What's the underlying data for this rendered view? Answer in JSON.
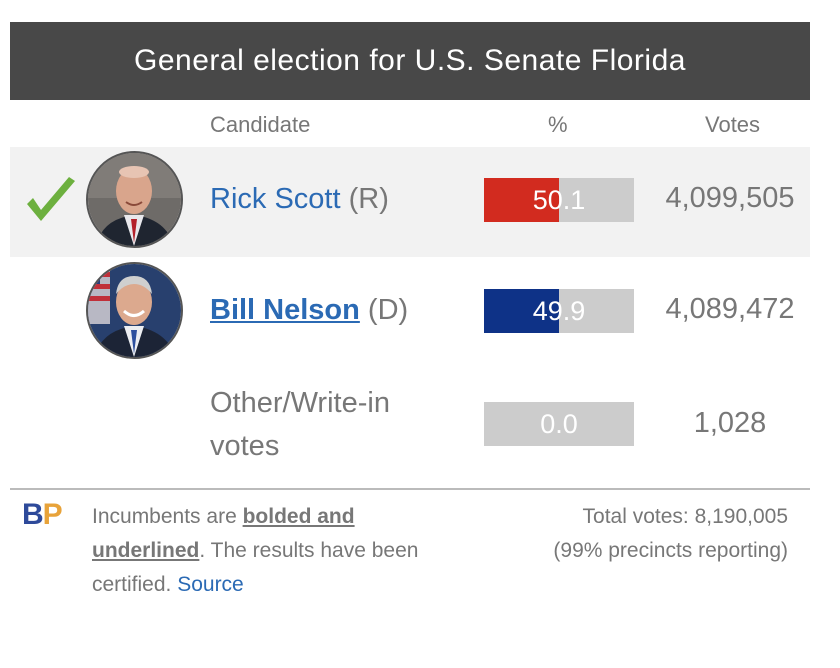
{
  "header": {
    "title": "General election for U.S. Senate Florida"
  },
  "columns": {
    "candidate": "Candidate",
    "percent": "%",
    "votes": "Votes"
  },
  "colors": {
    "republican": "#d22b1f",
    "democrat": "#0e3287",
    "bar_bg": "#cccccc",
    "winner_check": "#6db03f",
    "link": "#2b6ab4"
  },
  "candidates": [
    {
      "name": "Rick Scott",
      "party": "(R)",
      "percent": "50.1",
      "percent_value": 50.1,
      "votes": "4,099,505",
      "winner": true,
      "incumbent": false
    },
    {
      "name": "Bill Nelson",
      "party": "(D)",
      "percent": "49.9",
      "percent_value": 49.9,
      "votes": "4,089,472",
      "winner": false,
      "incumbent": true
    },
    {
      "name": "Other/Write-in votes",
      "party": "",
      "percent": "0.0",
      "percent_value": 0.0,
      "votes": "1,028",
      "winner": false,
      "incumbent": false
    }
  ],
  "footer": {
    "logo_b": "B",
    "logo_p": "P",
    "note_pre": "Incumbents are ",
    "note_emph": "bolded and underlined",
    "note_post": ". The results have been certified. ",
    "source_link": "Source",
    "total_votes": "Total votes: 8,190,005",
    "precincts": "(99% precincts reporting)"
  }
}
